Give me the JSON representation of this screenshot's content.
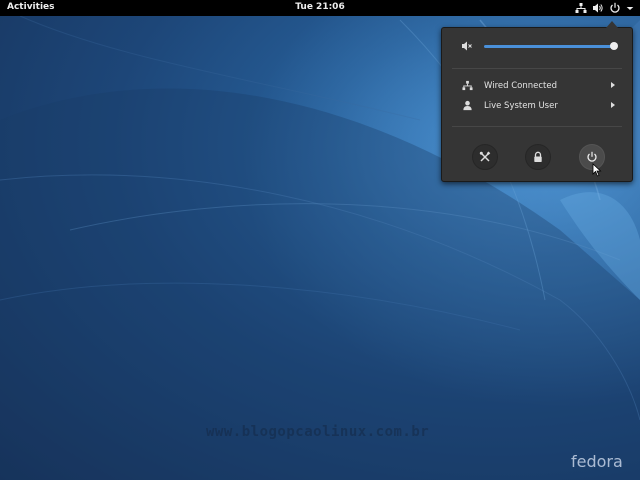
{
  "topbar": {
    "activities_label": "Activities",
    "clock": "Tue 21:06",
    "status_icons": [
      "network-wired-icon",
      "volume-icon",
      "power-icon",
      "menu-arrow-icon"
    ]
  },
  "system_menu": {
    "volume": {
      "icon": "volume-muted-icon",
      "level": 1.0
    },
    "items": [
      {
        "icon": "network-wired-icon",
        "label": "Wired Connected"
      },
      {
        "icon": "user-icon",
        "label": "Live System User"
      }
    ],
    "buttons": [
      {
        "icon": "settings-tools-icon",
        "name": "settings"
      },
      {
        "icon": "lock-icon",
        "name": "lock"
      },
      {
        "icon": "power-icon",
        "name": "power-off"
      }
    ]
  },
  "desktop": {
    "watermark": "www.blogopcaolinux.com.br",
    "brand": "fedora"
  },
  "colors": {
    "topbar_bg": "#000000",
    "menu_bg": "#353535",
    "accent": "#4a90d9",
    "wallpaper": "#1d4678"
  }
}
